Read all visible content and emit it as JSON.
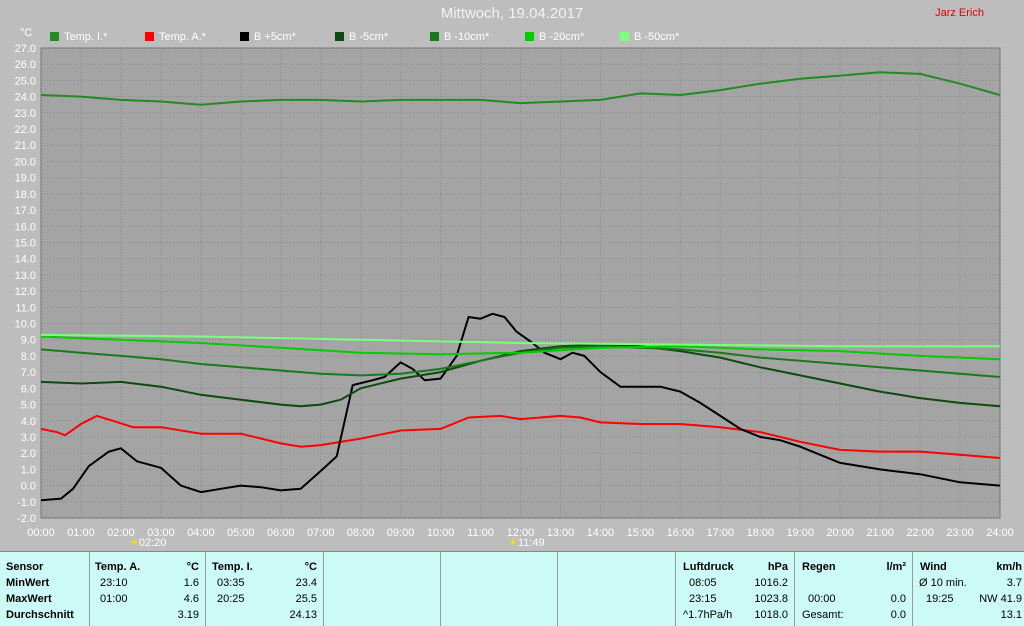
{
  "title": "Mittwoch, 19.04.2017",
  "author": "Jarz Erich",
  "unit": "°C",
  "legend": [
    {
      "label": "Temp. I.*",
      "color": "#228b22"
    },
    {
      "label": "Temp. A.*",
      "color": "#ff0000"
    },
    {
      "label": "B +5cm*",
      "color": "#000000"
    },
    {
      "label": "B -5cm*",
      "color": "#0d4a0d"
    },
    {
      "label": "B -10cm*",
      "color": "#1a7a1a"
    },
    {
      "label": "B -20cm*",
      "color": "#00cc00"
    },
    {
      "label": "B -50cm*",
      "color": "#7dff7d"
    }
  ],
  "markers": [
    {
      "time": "02:20",
      "label": "02:20"
    },
    {
      "time": "11:49",
      "label": "11:49"
    }
  ],
  "chart_data": {
    "type": "line",
    "title": "Mittwoch, 19.04.2017",
    "ylabel": "°C",
    "ylim": [
      -2.0,
      27.0
    ],
    "y_ticks": [
      "-2.0",
      "-1.0",
      "0.0",
      "1.0",
      "2.0",
      "3.0",
      "4.0",
      "5.0",
      "6.0",
      "7.0",
      "8.0",
      "9.0",
      "10.0",
      "11.0",
      "12.0",
      "13.0",
      "14.0",
      "15.0",
      "16.0",
      "17.0",
      "18.0",
      "19.0",
      "20.0",
      "21.0",
      "22.0",
      "23.0",
      "24.0",
      "25.0",
      "26.0",
      "27.0"
    ],
    "x_ticks": [
      "00:00",
      "01:00",
      "02:00",
      "03:00",
      "04:00",
      "05:00",
      "06:00",
      "07:00",
      "08:00",
      "09:00",
      "10:00",
      "11:00",
      "12:00",
      "13:00",
      "14:00",
      "15:00",
      "16:00",
      "17:00",
      "18:00",
      "19:00",
      "20:00",
      "21:00",
      "22:00",
      "23:00",
      "24:00"
    ],
    "xlim": [
      0,
      24
    ],
    "grid": true,
    "legend_position": "top",
    "series": [
      {
        "name": "Temp. I.*",
        "color": "#228b22",
        "points": [
          [
            0,
            24.1
          ],
          [
            1,
            24.0
          ],
          [
            2,
            23.8
          ],
          [
            3,
            23.7
          ],
          [
            4,
            23.5
          ],
          [
            5,
            23.7
          ],
          [
            6,
            23.8
          ],
          [
            7,
            23.8
          ],
          [
            8,
            23.7
          ],
          [
            9,
            23.8
          ],
          [
            10,
            23.8
          ],
          [
            11,
            23.8
          ],
          [
            12,
            23.6
          ],
          [
            13,
            23.7
          ],
          [
            14,
            23.8
          ],
          [
            15,
            24.2
          ],
          [
            16,
            24.1
          ],
          [
            17,
            24.4
          ],
          [
            18,
            24.8
          ],
          [
            19,
            25.1
          ],
          [
            20,
            25.3
          ],
          [
            21,
            25.5
          ],
          [
            22,
            25.4
          ],
          [
            23,
            24.8
          ],
          [
            24,
            24.1
          ]
        ]
      },
      {
        "name": "Temp. A.*",
        "color": "#ff0000",
        "points": [
          [
            0,
            3.5
          ],
          [
            0.4,
            3.3
          ],
          [
            0.6,
            3.1
          ],
          [
            1.0,
            3.8
          ],
          [
            1.4,
            4.3
          ],
          [
            1.8,
            4.0
          ],
          [
            2.3,
            3.6
          ],
          [
            3,
            3.6
          ],
          [
            4,
            3.2
          ],
          [
            5,
            3.2
          ],
          [
            6,
            2.6
          ],
          [
            6.5,
            2.4
          ],
          [
            7,
            2.5
          ],
          [
            8,
            2.9
          ],
          [
            9,
            3.4
          ],
          [
            10,
            3.5
          ],
          [
            10.7,
            4.2
          ],
          [
            11.5,
            4.3
          ],
          [
            12,
            4.1
          ],
          [
            13,
            4.3
          ],
          [
            13.5,
            4.2
          ],
          [
            14,
            3.9
          ],
          [
            15,
            3.8
          ],
          [
            16,
            3.8
          ],
          [
            17,
            3.6
          ],
          [
            18,
            3.3
          ],
          [
            19,
            2.7
          ],
          [
            20,
            2.2
          ],
          [
            21,
            2.1
          ],
          [
            22,
            2.1
          ],
          [
            23,
            1.9
          ],
          [
            24,
            1.7
          ]
        ]
      },
      {
        "name": "B +5cm*",
        "color": "#000000",
        "points": [
          [
            0,
            -0.9
          ],
          [
            0.5,
            -0.8
          ],
          [
            0.8,
            -0.2
          ],
          [
            1.2,
            1.2
          ],
          [
            1.7,
            2.1
          ],
          [
            2.0,
            2.3
          ],
          [
            2.4,
            1.5
          ],
          [
            3,
            1.1
          ],
          [
            3.5,
            0.0
          ],
          [
            4,
            -0.4
          ],
          [
            4.5,
            -0.2
          ],
          [
            5,
            0.0
          ],
          [
            5.5,
            -0.1
          ],
          [
            6,
            -0.3
          ],
          [
            6.5,
            -0.2
          ],
          [
            7,
            0.9
          ],
          [
            7.4,
            1.8
          ],
          [
            7.6,
            4.0
          ],
          [
            7.8,
            6.2
          ],
          [
            8.3,
            6.5
          ],
          [
            8.6,
            6.7
          ],
          [
            9,
            7.6
          ],
          [
            9.3,
            7.2
          ],
          [
            9.6,
            6.5
          ],
          [
            10,
            6.6
          ],
          [
            10.4,
            8.0
          ],
          [
            10.7,
            10.4
          ],
          [
            11,
            10.3
          ],
          [
            11.3,
            10.6
          ],
          [
            11.6,
            10.4
          ],
          [
            11.9,
            9.5
          ],
          [
            12.3,
            8.8
          ],
          [
            12.6,
            8.2
          ],
          [
            13,
            7.8
          ],
          [
            13.3,
            8.2
          ],
          [
            13.6,
            8.0
          ],
          [
            14,
            7.0
          ],
          [
            14.5,
            6.1
          ],
          [
            15,
            6.1
          ],
          [
            15.5,
            6.1
          ],
          [
            16,
            5.8
          ],
          [
            16.5,
            5.1
          ],
          [
            17,
            4.3
          ],
          [
            17.5,
            3.5
          ],
          [
            18,
            3.0
          ],
          [
            18.5,
            2.8
          ],
          [
            19,
            2.4
          ],
          [
            20,
            1.4
          ],
          [
            21,
            1.0
          ],
          [
            22,
            0.7
          ],
          [
            23,
            0.2
          ],
          [
            24,
            0.0
          ]
        ]
      },
      {
        "name": "B -5cm*",
        "color": "#0d4a0d",
        "points": [
          [
            0,
            6.4
          ],
          [
            1,
            6.3
          ],
          [
            2,
            6.4
          ],
          [
            3,
            6.1
          ],
          [
            4,
            5.6
          ],
          [
            5,
            5.3
          ],
          [
            6,
            5.0
          ],
          [
            6.5,
            4.9
          ],
          [
            7,
            5.0
          ],
          [
            7.5,
            5.3
          ],
          [
            8,
            6.0
          ],
          [
            9,
            6.6
          ],
          [
            10,
            7.0
          ],
          [
            11,
            7.7
          ],
          [
            12,
            8.3
          ],
          [
            13,
            8.6
          ],
          [
            14,
            8.7
          ],
          [
            15,
            8.6
          ],
          [
            16,
            8.3
          ],
          [
            17,
            7.9
          ],
          [
            18,
            7.3
          ],
          [
            19,
            6.8
          ],
          [
            20,
            6.3
          ],
          [
            21,
            5.8
          ],
          [
            22,
            5.4
          ],
          [
            23,
            5.1
          ],
          [
            24,
            4.9
          ]
        ]
      },
      {
        "name": "B -10cm*",
        "color": "#1a7a1a",
        "points": [
          [
            0,
            8.4
          ],
          [
            1,
            8.2
          ],
          [
            2,
            8.0
          ],
          [
            3,
            7.8
          ],
          [
            4,
            7.5
          ],
          [
            5,
            7.3
          ],
          [
            6,
            7.1
          ],
          [
            7,
            6.9
          ],
          [
            8,
            6.8
          ],
          [
            9,
            6.9
          ],
          [
            10,
            7.2
          ],
          [
            11,
            7.7
          ],
          [
            12,
            8.2
          ],
          [
            13,
            8.5
          ],
          [
            14,
            8.6
          ],
          [
            15,
            8.5
          ],
          [
            16,
            8.4
          ],
          [
            17,
            8.2
          ],
          [
            18,
            7.9
          ],
          [
            19,
            7.7
          ],
          [
            20,
            7.5
          ],
          [
            21,
            7.3
          ],
          [
            22,
            7.1
          ],
          [
            23,
            6.9
          ],
          [
            24,
            6.7
          ]
        ]
      },
      {
        "name": "B -20cm*",
        "color": "#00cc00",
        "points": [
          [
            0,
            9.2
          ],
          [
            2,
            9.0
          ],
          [
            4,
            8.8
          ],
          [
            6,
            8.5
          ],
          [
            8,
            8.2
          ],
          [
            10,
            8.1
          ],
          [
            12,
            8.2
          ],
          [
            14,
            8.5
          ],
          [
            16,
            8.6
          ],
          [
            18,
            8.4
          ],
          [
            20,
            8.3
          ],
          [
            22,
            8.0
          ],
          [
            24,
            7.8
          ]
        ]
      },
      {
        "name": "B -50cm*",
        "color": "#7dff7d",
        "points": [
          [
            0,
            9.3
          ],
          [
            4,
            9.2
          ],
          [
            8,
            9.0
          ],
          [
            12,
            8.8
          ],
          [
            16,
            8.7
          ],
          [
            20,
            8.6
          ],
          [
            24,
            8.6
          ]
        ]
      }
    ]
  },
  "panel": {
    "sensor": {
      "header": "Sensor",
      "rows": [
        "MinWert",
        "MaxWert",
        "Durchschnitt"
      ]
    },
    "temp_a": {
      "header": "Temp. A.",
      "unit": "°C",
      "min_time": "23:10",
      "min_val": "1.6",
      "max_time": "01:00",
      "max_val": "4.6",
      "avg": "3.19"
    },
    "temp_i": {
      "header": "Temp. I.",
      "unit": "°C",
      "min_time": "03:35",
      "min_val": "23.4",
      "max_time": "20:25",
      "max_val": "25.5",
      "avg": "24.13"
    },
    "pressure": {
      "header": "Luftdruck",
      "unit": "hPa",
      "min_time": "08:05",
      "min_val": "1016.2",
      "max_time": "23:15",
      "max_val": "1023.8",
      "trend": "^1.7hPa/h",
      "avg": "1018.0"
    },
    "rain": {
      "header": "Regen",
      "unit": "l/m²",
      "r1_time": "",
      "r1_val": "",
      "r2_time": "00:00",
      "r2_val": "0.0",
      "total_label": "Gesamt:",
      "total_val": "0.0"
    },
    "wind": {
      "header": "Wind",
      "unit": "km/h",
      "avg_label": "Ø 10 min.",
      "avg_val": "3.7",
      "max_time": "19:25",
      "max_val": "NW 41.9",
      "avg2": "13.1"
    }
  }
}
